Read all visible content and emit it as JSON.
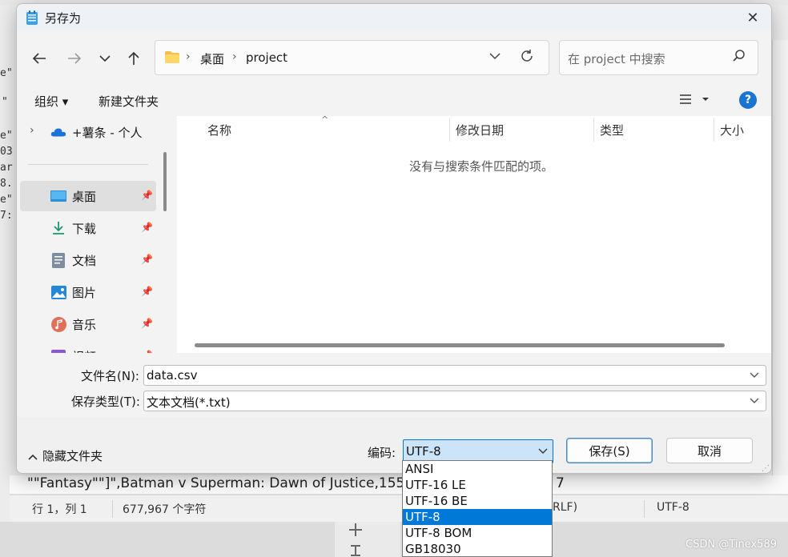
{
  "background": {
    "text_line": "\"\"Fantasy\"\"]\",Batman v Superman: Dawn of Justice,155",
    "text_line_end": "7",
    "left_fragments": [
      "e\"",
      "\"",
      "e\"",
      "03",
      "ar",
      "8.",
      "e\"",
      "7:"
    ],
    "status": {
      "position": "行 1，列 1",
      "chars": "677,967 个字符",
      "eol": "RLF)",
      "encoding": "UTF-8"
    },
    "watermark": "CSDN @Tinex589"
  },
  "dialog": {
    "title": "另存为",
    "close_label": "✕",
    "address": {
      "crumbs": [
        "桌面",
        "project"
      ]
    },
    "search": {
      "placeholder": "在 project 中搜索"
    },
    "toolbar": {
      "organize": "组织 ▾",
      "new_folder": "新建文件夹",
      "help": "?"
    },
    "nav_pane": {
      "onedrive": "+薯条 - 个人",
      "items": [
        {
          "label": "桌面",
          "icon": "desktop-icon"
        },
        {
          "label": "下载",
          "icon": "download-icon"
        },
        {
          "label": "文档",
          "icon": "document-icon"
        },
        {
          "label": "图片",
          "icon": "pictures-icon"
        },
        {
          "label": "音乐",
          "icon": "music-icon"
        },
        {
          "label": "视频",
          "icon": "video-icon"
        }
      ]
    },
    "file_list": {
      "columns": [
        "名称",
        "修改日期",
        "类型",
        "大小"
      ],
      "empty_message": "没有与搜索条件匹配的项。"
    },
    "filename": {
      "label": "文件名(N):",
      "value": "data.csv"
    },
    "filetype": {
      "label": "保存类型(T):",
      "value": "文本文档(*.txt)"
    },
    "hide_folders": "隐藏文件夹",
    "encoding": {
      "label": "编码:",
      "value": "UTF-8",
      "options": [
        "ANSI",
        "UTF-16 LE",
        "UTF-16 BE",
        "UTF-8",
        "UTF-8 BOM",
        "GB18030"
      ],
      "selected_index": 3
    },
    "save_button": "保存(S)",
    "cancel_button": "取消"
  },
  "colors": {
    "accent": "#0078d7",
    "help_icon": "#1a75d2",
    "selection_bg": "#cce4f7"
  }
}
